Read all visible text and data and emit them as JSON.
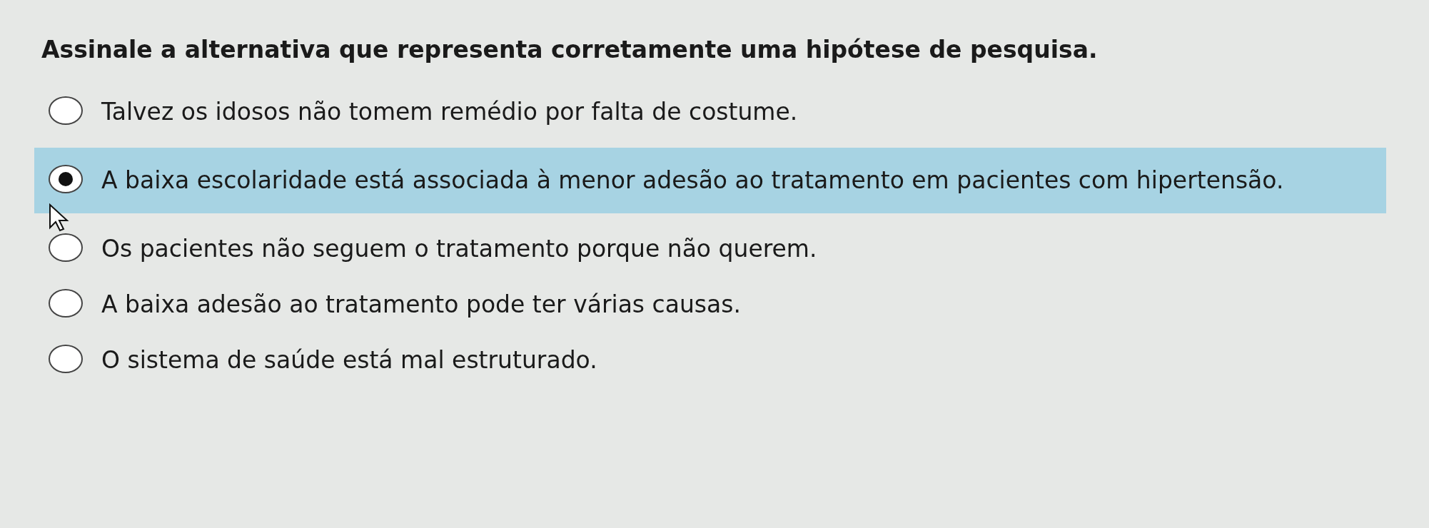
{
  "question": "Assinale a alternativa que representa corretamente uma hipótese de pesquisa.",
  "options": [
    {
      "label": "Talvez os idosos não tomem remédio por falta de costume.",
      "selected": false
    },
    {
      "label": "A baixa escolaridade está associada à menor adesão ao tratamento em pacientes com hipertensão.",
      "selected": true
    },
    {
      "label": "Os pacientes não seguem o tratamento porque não querem.",
      "selected": false
    },
    {
      "label": "A baixa adesão ao tratamento pode ter várias causas.",
      "selected": false
    },
    {
      "label": "O sistema de saúde está mal estruturado.",
      "selected": false
    }
  ]
}
